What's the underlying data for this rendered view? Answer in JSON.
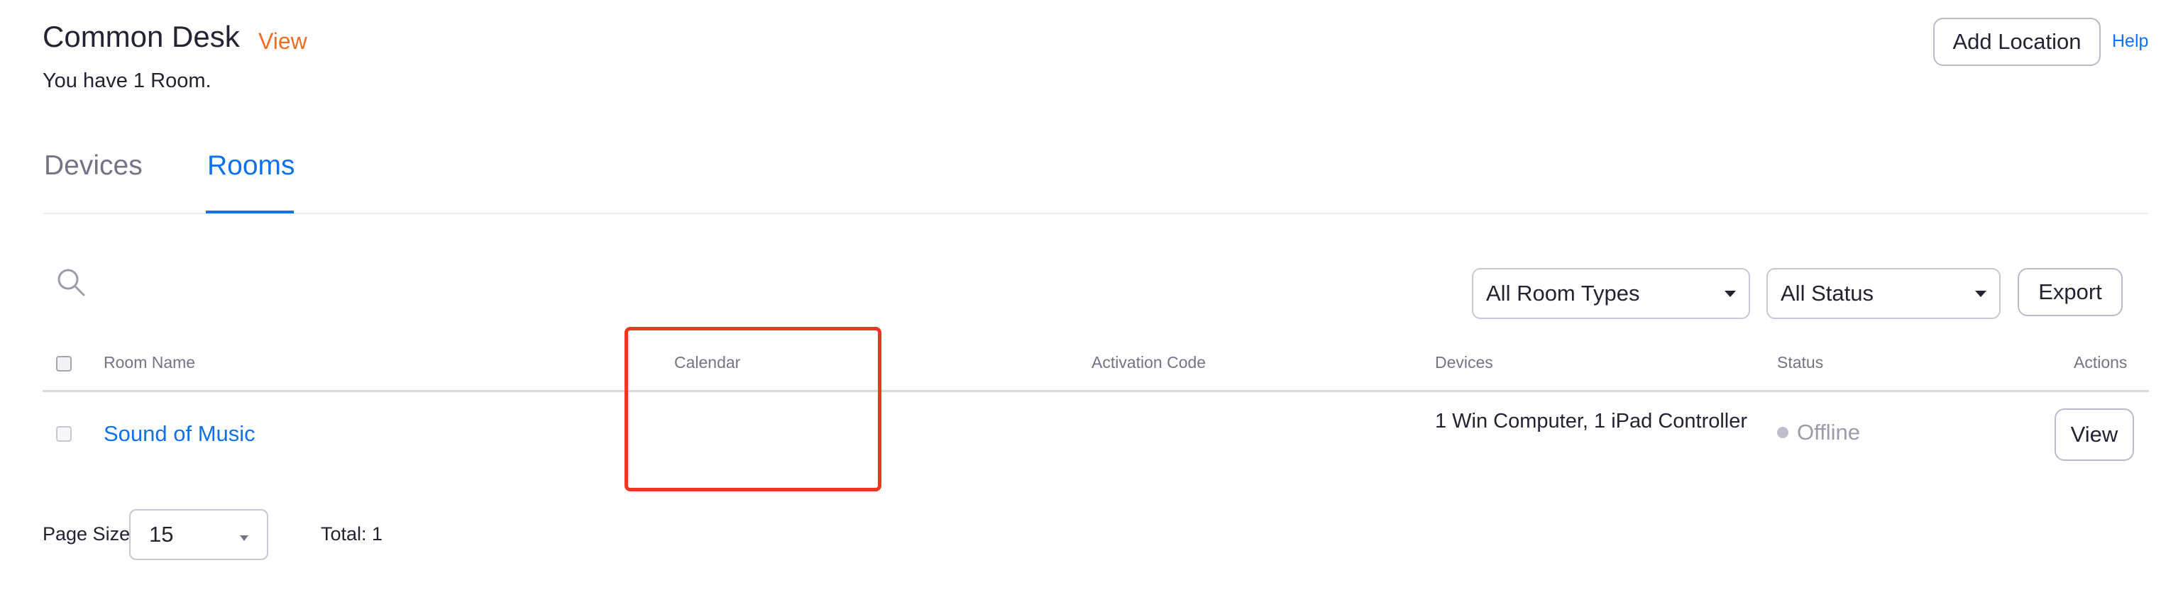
{
  "header": {
    "title": "Common Desk",
    "view_link": "View",
    "subtitle": "You have 1 Room.",
    "add_location_label": "Add Location",
    "help_label": "Help"
  },
  "tabs": [
    {
      "label": "Devices",
      "active": false
    },
    {
      "label": "Rooms",
      "active": true
    }
  ],
  "toolbar": {
    "search_icon": "search-icon",
    "room_type_filter": {
      "selected": "All Room Types"
    },
    "status_filter": {
      "selected": "All Status"
    },
    "export_label": "Export"
  },
  "table": {
    "columns": [
      "Room Name",
      "Calendar",
      "Activation Code",
      "Devices",
      "Status",
      "Actions"
    ],
    "rows": [
      {
        "room_name": "Sound of Music",
        "calendar": "",
        "activation_code": "",
        "devices": "1 Win Computer, 1 iPad Controller",
        "status": "Offline",
        "action_label": "View"
      }
    ]
  },
  "pagination": {
    "page_size_label": "Page Size",
    "page_size_value": "15",
    "total_label": "Total: 1"
  },
  "colors": {
    "accent": "#0e72ed",
    "view_link": "#f26d21",
    "highlight_box": "#f0361f",
    "offline_dot": "#bfbfcb"
  }
}
